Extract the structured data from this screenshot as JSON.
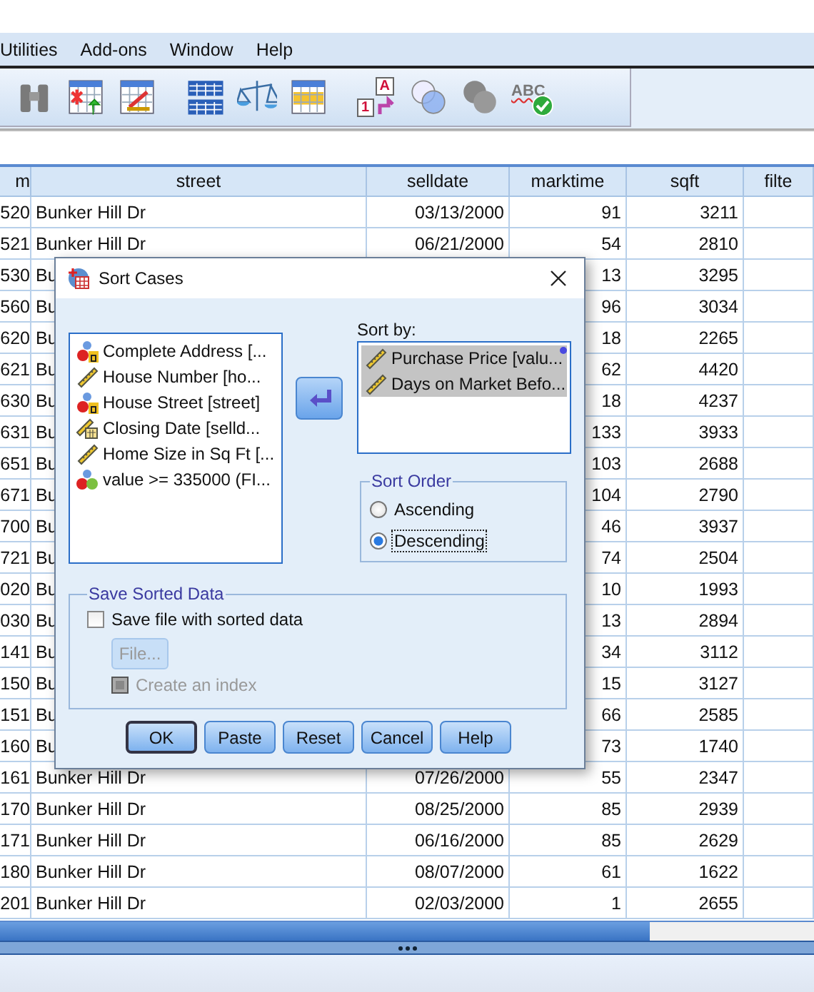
{
  "menu": [
    {
      "label": "Utilities"
    },
    {
      "label": "Add-ons"
    },
    {
      "label": "Window"
    },
    {
      "label": "Help"
    }
  ],
  "toolbar": [
    {
      "kind": "find"
    },
    {
      "kind": "insert-cases"
    },
    {
      "kind": "insert-variable"
    },
    {
      "kind": "split"
    },
    {
      "kind": "weight"
    },
    {
      "kind": "select"
    },
    {
      "kind": "value-labels",
      "letter": "A",
      "digit": "1"
    },
    {
      "kind": "sets"
    },
    {
      "kind": "sets-gray"
    },
    {
      "kind": "spell",
      "letters": "ABC"
    }
  ],
  "table": {
    "columns": [
      "m",
      "street",
      "selldate",
      "marktime",
      "sqft",
      "filte"
    ],
    "rows": [
      {
        "m": "520",
        "street": "Bunker Hill Dr",
        "selldate": "03/13/2000",
        "marktime": "91",
        "sqft": "3211"
      },
      {
        "m": "521",
        "street": "Bunker Hill Dr",
        "selldate": "06/21/2000",
        "marktime": "54",
        "sqft": "2810"
      },
      {
        "m": "530",
        "street": "Bu",
        "marktime": "13",
        "sqft": "3295"
      },
      {
        "m": "560",
        "street": "Bu",
        "marktime": "96",
        "sqft": "3034"
      },
      {
        "m": "620",
        "street": "Bu",
        "marktime": "18",
        "sqft": "2265"
      },
      {
        "m": "621",
        "street": "Bu",
        "marktime": "62",
        "sqft": "4420"
      },
      {
        "m": "630",
        "street": "Bu",
        "marktime": "18",
        "sqft": "4237"
      },
      {
        "m": "631",
        "street": "Bu",
        "marktime": "133",
        "sqft": "3933"
      },
      {
        "m": "651",
        "street": "Bu",
        "marktime": "103",
        "sqft": "2688"
      },
      {
        "m": "671",
        "street": "Bu",
        "marktime": "104",
        "sqft": "2790"
      },
      {
        "m": "700",
        "street": "Bu",
        "marktime": "46",
        "sqft": "3937"
      },
      {
        "m": "721",
        "street": "Bu",
        "marktime": "74",
        "sqft": "2504"
      },
      {
        "m": "020",
        "street": "Bu",
        "marktime": "10",
        "sqft": "1993"
      },
      {
        "m": "030",
        "street": "Bu",
        "marktime": "13",
        "sqft": "2894"
      },
      {
        "m": "141",
        "street": "Bu",
        "marktime": "34",
        "sqft": "3112"
      },
      {
        "m": "150",
        "street": "Bu",
        "marktime": "15",
        "sqft": "3127"
      },
      {
        "m": "151",
        "street": "Bu",
        "marktime": "66",
        "sqft": "2585"
      },
      {
        "m": "160",
        "street": "Bu",
        "marktime": "73",
        "sqft": "1740"
      },
      {
        "m": "161",
        "street": "Bunker Hill Dr",
        "selldate": "07/26/2000",
        "marktime": "55",
        "sqft": "2347"
      },
      {
        "m": "170",
        "street": "Bunker Hill Dr",
        "selldate": "08/25/2000",
        "marktime": "85",
        "sqft": "2939"
      },
      {
        "m": "171",
        "street": "Bunker Hill Dr",
        "selldate": "06/16/2000",
        "marktime": "85",
        "sqft": "2629"
      },
      {
        "m": "180",
        "street": "Bunker Hill Dr",
        "selldate": "08/07/2000",
        "marktime": "61",
        "sqft": "1622"
      },
      {
        "m": "201",
        "street": "Bunker Hill Dr",
        "selldate": "02/03/2000",
        "marktime": "1",
        "sqft": "2655"
      }
    ]
  },
  "dialog": {
    "title": "Sort Cases",
    "variables": [
      {
        "kind": "string",
        "label": "Complete Address [...",
        "selected": false
      },
      {
        "kind": "scale",
        "label": "House Number [ho...",
        "selected": false
      },
      {
        "kind": "string",
        "label": "House Street [street]",
        "selected": false
      },
      {
        "kind": "date",
        "label": "Closing Date [selld...",
        "selected": false
      },
      {
        "kind": "scale",
        "label": "Home Size in Sq Ft [...",
        "selected": false
      },
      {
        "kind": "nominal",
        "label": "value >= 335000 (FI...",
        "selected": false
      }
    ],
    "sort_by_label": "Sort by:",
    "sort_by": [
      {
        "kind": "scale",
        "label": "Purchase Price [valu...",
        "selected": true
      },
      {
        "kind": "scale",
        "label": "Days on Market Befo...",
        "selected": true
      }
    ],
    "sort_order": {
      "title": "Sort Order",
      "options": [
        {
          "label": "Ascending",
          "selected": false
        },
        {
          "label": "Descending",
          "selected": true
        }
      ]
    },
    "save": {
      "title": "Save Sorted Data",
      "checkbox": {
        "label": "Save file with sorted data",
        "checked": false
      },
      "file_button": {
        "label": "File...",
        "disabled": true
      },
      "index": {
        "label": "Create an index",
        "checked": false,
        "disabled": true
      }
    },
    "buttons": [
      {
        "label": "OK",
        "default": true
      },
      {
        "label": "Paste",
        "default": false
      },
      {
        "label": "Reset",
        "default": false
      },
      {
        "label": "Cancel",
        "default": false
      },
      {
        "label": "Help",
        "default": false
      }
    ]
  }
}
